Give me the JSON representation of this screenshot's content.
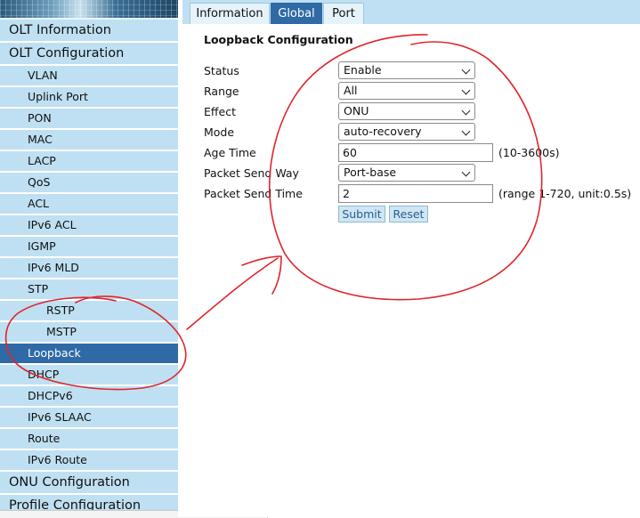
{
  "tabs": [
    {
      "label": "Information",
      "active": false
    },
    {
      "label": "Global",
      "active": true
    },
    {
      "label": "Port",
      "active": false
    }
  ],
  "sidebar": {
    "sections": [
      {
        "label": "OLT Information"
      },
      {
        "label": "OLT Configuration"
      },
      {
        "label": "ONU Configuration"
      },
      {
        "label": "Profile Configuration"
      }
    ],
    "items": [
      {
        "label": "VLAN"
      },
      {
        "label": "Uplink Port"
      },
      {
        "label": "PON"
      },
      {
        "label": "MAC"
      },
      {
        "label": "LACP"
      },
      {
        "label": "QoS"
      },
      {
        "label": "ACL"
      },
      {
        "label": "IPv6 ACL"
      },
      {
        "label": "IGMP"
      },
      {
        "label": "IPv6 MLD"
      },
      {
        "label": "STP"
      },
      {
        "label": "RSTP"
      },
      {
        "label": "MSTP"
      },
      {
        "label": "Loopback",
        "active": true
      },
      {
        "label": "DHCP"
      },
      {
        "label": "DHCPv6"
      },
      {
        "label": "IPv6 SLAAC"
      },
      {
        "label": "Route"
      },
      {
        "label": "IPv6 Route"
      }
    ]
  },
  "form": {
    "title": "Loopback Configuration",
    "status": {
      "label": "Status",
      "value": "Enable"
    },
    "range": {
      "label": "Range",
      "value": "All"
    },
    "effect": {
      "label": "Effect",
      "value": "ONU"
    },
    "mode": {
      "label": "Mode",
      "value": "auto-recovery"
    },
    "age_time": {
      "label": "Age Time",
      "value": "60",
      "hint": "(10-3600s)"
    },
    "packet_send_way": {
      "label": "Packet Send Way",
      "value": "Port-base"
    },
    "packet_send_time": {
      "label": "Packet Send Time",
      "value": "2",
      "hint": "(range 1-720, unit:0.5s)"
    },
    "submit_label": "Submit",
    "reset_label": "Reset"
  },
  "colors": {
    "accent": "#2f6aa6",
    "nav_bg": "#bfe0f2",
    "annotation": "#e0242a"
  },
  "annotation": {
    "color": "red",
    "shapes": [
      "circle-around-form",
      "circle-around-loopback",
      "arrow-to-form"
    ]
  }
}
